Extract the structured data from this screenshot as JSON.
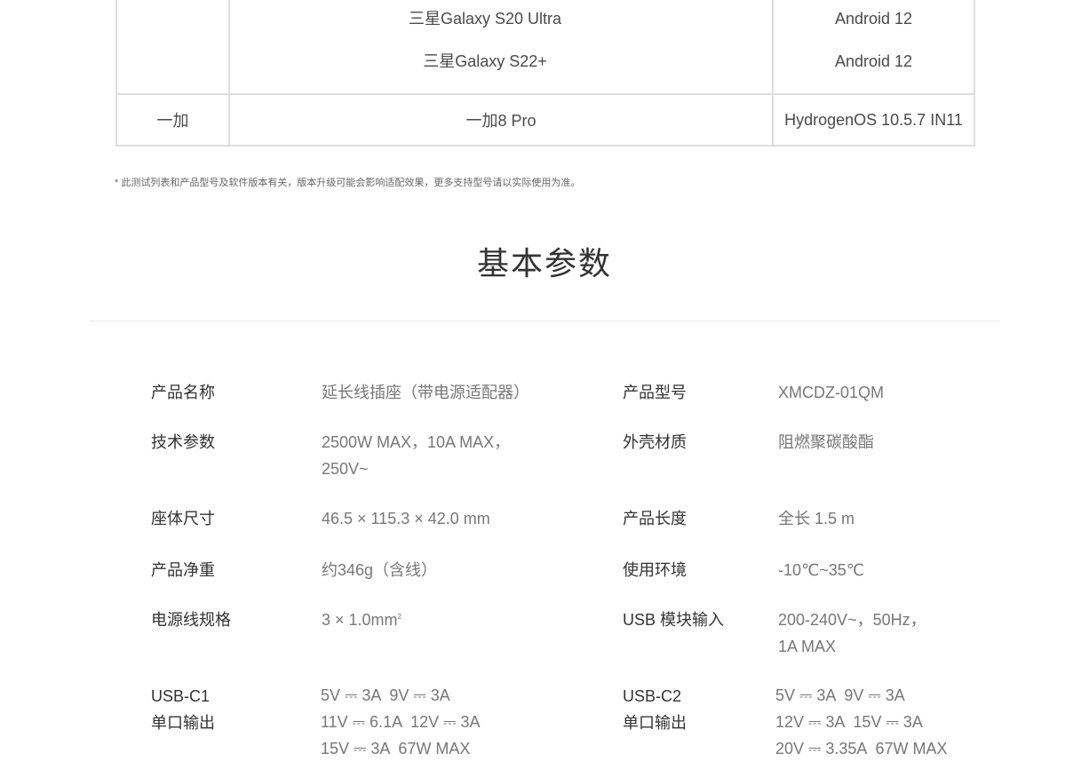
{
  "compat_table": {
    "rows": [
      {
        "brand": "",
        "models": [
          "三星Galaxy S20 Ultra",
          "三星Galaxy S22+"
        ],
        "systems": [
          "Android 12",
          "Android 12"
        ]
      },
      {
        "brand": "一加",
        "models": [
          "一加8 Pro"
        ],
        "systems": [
          "HydrogenOS 10.5.7 IN11"
        ]
      }
    ]
  },
  "footnote": "* 此测试列表和产品型号及软件版本有关，版本升级可能会影响适配效果，更多支持型号请以实际使用为准。",
  "section_title": "基本参数",
  "specs": {
    "name_label": "产品名称",
    "name_value": "延长线插座（带电源适配器）",
    "model_label": "产品型号",
    "model_value": "XMCDZ-01QM",
    "tech_label": "技术参数",
    "tech_value": "2500W MAX，10A MAX，\n250V~",
    "shell_label": "外壳材质",
    "shell_value": "阻燃聚碳酸酯",
    "size_label": "座体尺寸",
    "size_value": "46.5 × 115.3 × 42.0 mm",
    "length_label": "产品长度",
    "length_value": "全长 1.5 m",
    "weight_label": "产品净重",
    "weight_value": "约346g（含线）",
    "env_label": "使用环境",
    "env_value": "-10℃~35℃",
    "cable_label": "电源线规格",
    "cable_value": "3 × 1.0mm",
    "cable_sup": "2",
    "usb_in_label": "USB 模块输入",
    "usb_in_value": "200-240V~，50Hz，\n1A MAX",
    "c1_label": "USB-C1\n单口输出",
    "c1_value": "5V ⎓ 3A  9V ⎓ 3A\n11V ⎓ 6.1A  12V ⎓ 3A\n15V ⎓ 3A  67W MAX",
    "c2_label": "USB-C2\n单口输出",
    "c2_value": "5V ⎓ 3A  9V ⎓ 3A\n12V ⎓ 3A  15V ⎓ 3A\n20V ⎓ 3.35A  67W MAX"
  }
}
